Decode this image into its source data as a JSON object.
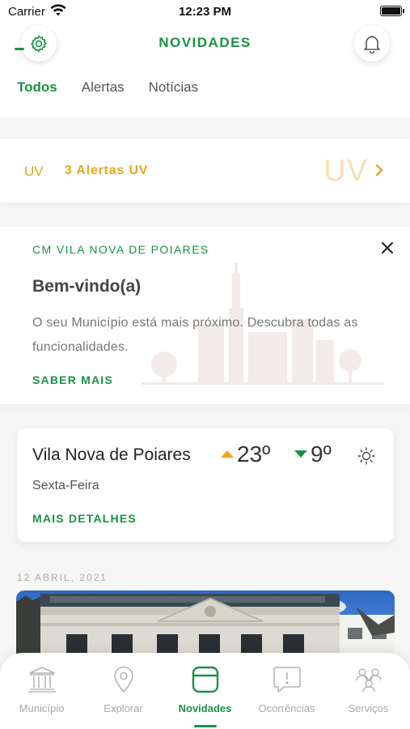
{
  "status_bar": {
    "carrier": "Carrier",
    "time": "12:23 PM"
  },
  "header": {
    "title": "NOVIDADES",
    "tabs": [
      {
        "label": "Todos",
        "active": true
      },
      {
        "label": "Alertas",
        "active": false
      },
      {
        "label": "Notícias",
        "active": false
      }
    ]
  },
  "uv_alert": {
    "prefix": "UV",
    "text": "3 Alertas UV",
    "big_label": "UV"
  },
  "welcome": {
    "organization": "CM VILA NOVA DE POIARES",
    "title": "Bem-vindo(a)",
    "body": "O seu Município está mais próximo. Descubra todas as funcionalidades.",
    "link": "SABER MAIS"
  },
  "weather": {
    "city": "Vila Nova de Poiares",
    "max_temp": "23º",
    "min_temp": "9º",
    "day": "Sexta-Feira",
    "link": "MAIS DETALHES",
    "condition_icon": "sun-icon"
  },
  "news": {
    "date": "12 ABRIL, 2021"
  },
  "tab_bar": {
    "items": [
      {
        "label": "Município",
        "icon": "building-icon",
        "active": false
      },
      {
        "label": "Explorar",
        "icon": "map-pin-icon",
        "active": false
      },
      {
        "label": "Novidades",
        "icon": "news-icon",
        "active": true
      },
      {
        "label": "Ocorrências",
        "icon": "alert-bubble-icon",
        "active": false
      },
      {
        "label": "Serviços",
        "icon": "services-icon",
        "active": false
      }
    ]
  },
  "colors": {
    "brand_green": "#1a9146",
    "uv_amber": "#e8a820",
    "temp_max": "#f0a51e",
    "temp_min": "#1a9146"
  }
}
